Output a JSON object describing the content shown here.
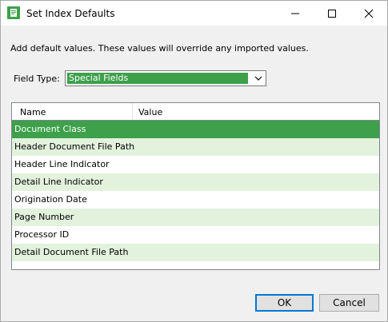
{
  "window": {
    "title": "Set Index Defaults",
    "icon": "document-index-icon"
  },
  "description": "Add default values. These values will override any imported values.",
  "field_type": {
    "label": "Field Type:",
    "selected": "Special Fields"
  },
  "grid": {
    "columns": [
      "Name",
      "Value"
    ],
    "rows": [
      {
        "name": "Document Class",
        "value": "",
        "selected": true
      },
      {
        "name": "Header Document File Path",
        "value": ""
      },
      {
        "name": "Header Line Indicator",
        "value": ""
      },
      {
        "name": "Detail Line Indicator",
        "value": ""
      },
      {
        "name": "Origination Date",
        "value": ""
      },
      {
        "name": "Page Number",
        "value": ""
      },
      {
        "name": "Processor ID",
        "value": ""
      },
      {
        "name": "Detail Document File Path",
        "value": ""
      }
    ]
  },
  "buttons": {
    "ok": "OK",
    "cancel": "Cancel"
  },
  "colors": {
    "accent_green": "#3ea04b",
    "alt_row": "#e2f2dd",
    "focus_border": "#0078d7"
  }
}
